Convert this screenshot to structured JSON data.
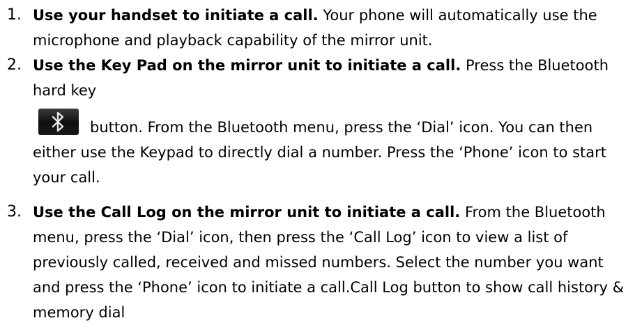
{
  "steps": [
    {
      "number": "1.",
      "title": "Use your handset to initiate a call.",
      "body": " Your phone will automatically use the microphone and playback capability of the mirror unit."
    },
    {
      "number": "2.",
      "title": "Use the Key Pad on the mirror unit to initiate a call.",
      "body_a": " Press the Bluetooth hard key",
      "body_b": "button. From the Bluetooth menu, press the ‘Dial’ icon. You can then either use the Keypad to directly dial a number. Press the ‘Phone’ icon to start your call."
    },
    {
      "number": "3.",
      "title": "Use the Call Log on the mirror unit to initiate a call.",
      "body": " From the Bluetooth menu, press the ‘Dial’ icon, then press the ‘Call Log’ icon to view a list of previously called, received and missed numbers. Select the number you want and press the ‘Phone’ icon to initiate a call.Call Log button to show call history & memory dial"
    }
  ],
  "icons": {
    "bluetooth_key": "bluetooth-icon"
  }
}
